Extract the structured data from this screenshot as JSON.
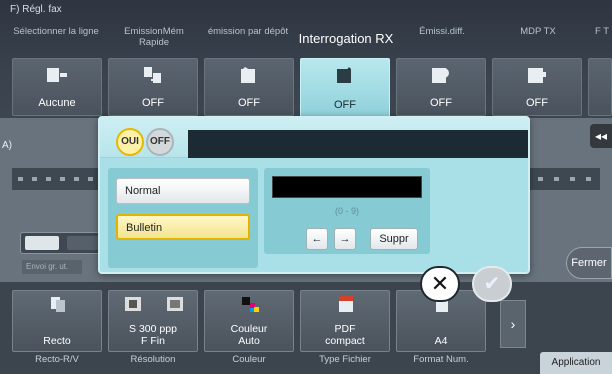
{
  "header": {
    "breadcrumb": "F)  Régl. fax",
    "tabs": [
      {
        "label": "Sélectionner la ligne",
        "value": "Aucune",
        "icon": "line-select-icon",
        "active": false
      },
      {
        "label": "EmissionMém Rapide",
        "value": "OFF",
        "icon": "quick-memory-tx-icon",
        "active": false
      },
      {
        "label": "émission par dépôt",
        "value": "OFF",
        "icon": "polling-tx-icon",
        "active": false
      },
      {
        "label": "Interrogation RX",
        "value": "OFF",
        "icon": "polling-rx-icon",
        "active": true
      },
      {
        "label": "Émissi.diff.",
        "value": "OFF",
        "icon": "timer-tx-icon",
        "active": false
      },
      {
        "label": "MDP TX",
        "value": "OFF",
        "icon": "password-tx-icon",
        "active": false
      },
      {
        "label": "F T",
        "value": "",
        "icon": "",
        "active": false
      }
    ]
  },
  "middle": {
    "left_label": "A)",
    "envoi_label": "Envoi gr. ut.",
    "close_label": "Fermer"
  },
  "popup": {
    "toggle_on": "OUI",
    "toggle_off": "OFF",
    "choices": [
      "Normal",
      "Bulletin"
    ],
    "selected_choice": "Bulletin",
    "number_value": "",
    "range_hint": "(0 - 9)",
    "left_arrow": "←",
    "right_arrow": "→",
    "delete_label": "Suppr",
    "cancel_symbol": "✕",
    "ok_symbol": "✔"
  },
  "bottom": {
    "tiles": [
      {
        "value": "Recto",
        "caption": "Recto-R/V",
        "icon": "duplex-icon"
      },
      {
        "value": "S 300 ppp\nF Fin",
        "caption": "Résolution",
        "icon": "resolution-icon"
      },
      {
        "value": "Couleur\nAuto",
        "caption": "Couleur",
        "icon": "color-icon"
      },
      {
        "value": "PDF\ncompact",
        "caption": "Type Fichier",
        "icon": "pdf-icon"
      },
      {
        "value": "A4",
        "caption": "Format Num.",
        "icon": "scan-size-icon"
      }
    ],
    "more_symbol": "›",
    "application_tab": "Application"
  },
  "colors": {
    "active_tile": "#9fd9e1",
    "popup_bg": "#a9dfe6",
    "selected_choice": "#f3e48f",
    "on_toggle_border": "#e6b800"
  }
}
